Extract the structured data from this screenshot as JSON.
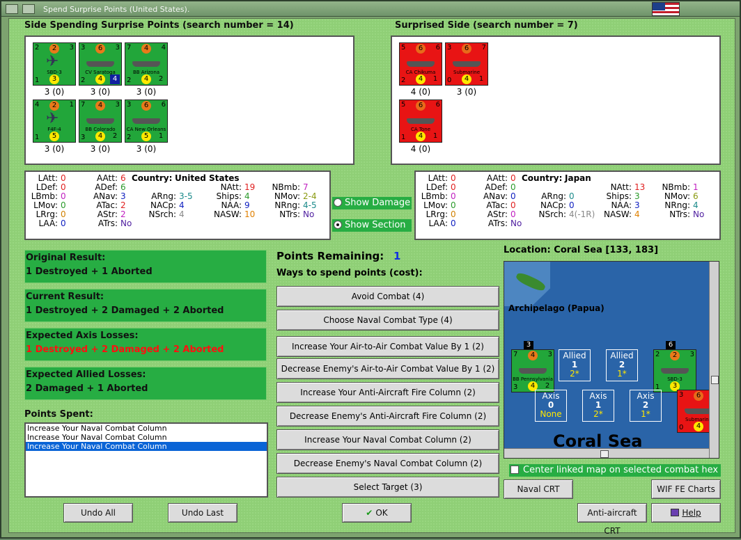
{
  "window": {
    "title": "Spend Surprise Points (United States)."
  },
  "left_side": {
    "header": "Side Spending Surprise Points (search number = 14)",
    "units": [
      {
        "name": "SBD-3",
        "tl": "2",
        "orange": "2",
        "tr": "3",
        "bl": "1",
        "yellow": "3",
        "count": "3 (0)",
        "kind": "plane"
      },
      {
        "name": "CV Saratoga",
        "tl": "3",
        "orange": "6",
        "tr": "3",
        "bl": "2",
        "yellow": "4",
        "br": "4",
        "count": "3 (0)",
        "kind": "ship"
      },
      {
        "name": "BB Arizona",
        "tl": "7",
        "orange": "4",
        "tr": "4",
        "bl": "2",
        "yellow": "4",
        "br": "2",
        "count": "3 (0)",
        "kind": "ship"
      },
      {
        "name": "F4F-4",
        "tl": "4",
        "orange": "2",
        "tr": "1",
        "bl": "1",
        "yellow": "5",
        "count": "3 (0)",
        "kind": "plane"
      },
      {
        "name": "BB Colorado",
        "tl": "7",
        "orange": "4",
        "tr": "3",
        "bl": "3",
        "yellow": "4",
        "br": "2",
        "count": "3 (0)",
        "kind": "ship"
      },
      {
        "name": "CA New Orleans",
        "tl": "3",
        "orange": "6",
        "tr": "6",
        "bl": "2",
        "yellow": "5",
        "br": "1",
        "count": "3 (0)",
        "kind": "ship"
      }
    ]
  },
  "right_side": {
    "header": "Surprised Side (search number = 7)",
    "units": [
      {
        "name": "CA Chikuma",
        "tl": "5",
        "orange": "6",
        "tr": "6",
        "bl": "2",
        "yellow": "4",
        "br": "1",
        "count": "4 (0)"
      },
      {
        "name": "Submarine",
        "tl": "3",
        "orange": "6",
        "tr": "7",
        "bl": "0",
        "yellow": "4",
        "br": "1",
        "count": "3 (0)"
      },
      {
        "name": "CA Tone",
        "tl": "5",
        "orange": "6",
        "tr": "6",
        "bl": "1",
        "yellow": "4",
        "br": "1",
        "count": "4 (0)"
      }
    ]
  },
  "us_stats": {
    "country_label": "Country:",
    "country": "United States",
    "latt": "0",
    "ldef": "0",
    "lbmb": "0",
    "lmov": "0",
    "lrrg": "0",
    "laa": "0",
    "aatt": "6",
    "adef": "6",
    "anav": "3",
    "atac": "2",
    "astr": "2",
    "atrs": "No",
    "arng": "3-5",
    "nacp": "4",
    "nsrch": "4",
    "natt": "19",
    "ships": "4",
    "naa": "9",
    "nasw": "10",
    "nbmb": "7",
    "nmov": "2-4",
    "nrng": "4-5",
    "ntrs": "No"
  },
  "jp_stats": {
    "country_label": "Country:",
    "country": "Japan",
    "latt": "0",
    "ldef": "0",
    "lbmb": "0",
    "lmov": "0",
    "lrrg": "0",
    "laa": "0",
    "aatt": "0",
    "adef": "0",
    "anav": "0",
    "atac": "0",
    "astr": "0",
    "atrs": "No",
    "arng": "0",
    "nacp": "0",
    "nsrch": "4(-1R)",
    "natt": "13",
    "ships": "3",
    "naa": "3",
    "nasw": "4",
    "nbmb": "1",
    "nmov": "6",
    "nrng": "4",
    "ntrs": "No"
  },
  "labels": {
    "latt": "LAtt:",
    "ldef": "LDef:",
    "lbmb": "LBmb:",
    "lmov": "LMov:",
    "lrrg": "LRrg:",
    "laa": "LAA:",
    "aatt": "AAtt:",
    "adef": "ADef:",
    "anav": "ANav:",
    "atac": "ATac:",
    "astr": "AStr:",
    "atrs": "ATrs:",
    "arng": "ARng:",
    "nacp": "NACp:",
    "nsrch": "NSrch:",
    "natt": "NAtt:",
    "ships": "Ships:",
    "naa": "NAA:",
    "nasw": "NASW:",
    "nbmb": "NBmb:",
    "nmov": "NMov:",
    "nrng": "NRng:",
    "ntrs": "NTrs:"
  },
  "radios": {
    "show_damage": "Show Damage",
    "show_section": "Show Section"
  },
  "results": [
    {
      "title": "Original Result:",
      "value": "1 Destroyed + 1 Aborted"
    },
    {
      "title": "Current Result:",
      "value": "1 Destroyed + 2 Damaged + 2 Aborted"
    },
    {
      "title": "Expected Axis Losses:",
      "value": "1 Destroyed + 2 Damaged + 2 Aborted"
    },
    {
      "title": "Expected Allied Losses:",
      "value": "2 Damaged + 1 Aborted"
    }
  ],
  "points_spent": {
    "label": "Points Spent:",
    "items": [
      "Increase Your Naval Combat Column",
      "Increase Your Naval Combat Column",
      "Increase Your Naval Combat Column"
    ]
  },
  "points": {
    "remaining_label": "Points Remaining:",
    "remaining": "1",
    "ways_label": "Ways to spend points (cost):"
  },
  "ways": [
    "Avoid Combat (4)",
    "Choose Naval Combat Type (4)",
    "Increase Your Air-to-Air Combat Value By 1 (2)",
    "Decrease Enemy's Air-to-Air Combat Value By 1 (2)",
    "Increase Your Anti-Aircraft Fire Column (2)",
    "Decrease Enemy's Anti-Aircraft Fire Column (2)",
    "Increase Your Naval Combat Column (2)",
    "Decrease Enemy's Naval Combat Column (2)",
    "Select Target (3)"
  ],
  "map": {
    "location": "Location: Coral Sea [133, 183]",
    "archipelago": "Archipelago (Papua)",
    "sea": "Coral Sea",
    "allied": [
      {
        "t": "Allied",
        "n": "1",
        "s": "2*"
      },
      {
        "t": "Allied",
        "n": "2",
        "s": "1*"
      }
    ],
    "axis": [
      {
        "t": "Axis",
        "n": "0",
        "s": "None"
      },
      {
        "t": "Axis",
        "n": "1",
        "s": "2*"
      },
      {
        "t": "Axis",
        "n": "2",
        "s": "1*"
      }
    ],
    "stack_a": "3",
    "stack_b": "6",
    "unit_a": {
      "name": "BB Pennsylvania",
      "tl": "7",
      "orange": "4",
      "tr": "3",
      "bl": "3",
      "yellow": "4",
      "br": "2"
    },
    "unit_b": {
      "name": "SBD-3",
      "tl": "2",
      "orange": "2",
      "tr": "3",
      "bl": "1",
      "yellow": "3"
    },
    "unit_c": {
      "name": "Submarine",
      "orange": "6",
      "tl": "3",
      "bl": "0",
      "yellow": "4"
    }
  },
  "center_linked": "Center linked map on selected combat hex",
  "buttons": {
    "naval_crt": "Naval CRT",
    "wif_fe": "WIF FE Charts",
    "aa_crt": "Anti-aircraft CRT",
    "help": "Help",
    "undo_all": "Undo All",
    "undo_last": "Undo Last",
    "ok": "OK"
  },
  "colors": {
    "panel_green": "#27ad43",
    "unit_green": "#22a63a",
    "unit_red": "#e81414",
    "selected": "#0a64d6"
  }
}
